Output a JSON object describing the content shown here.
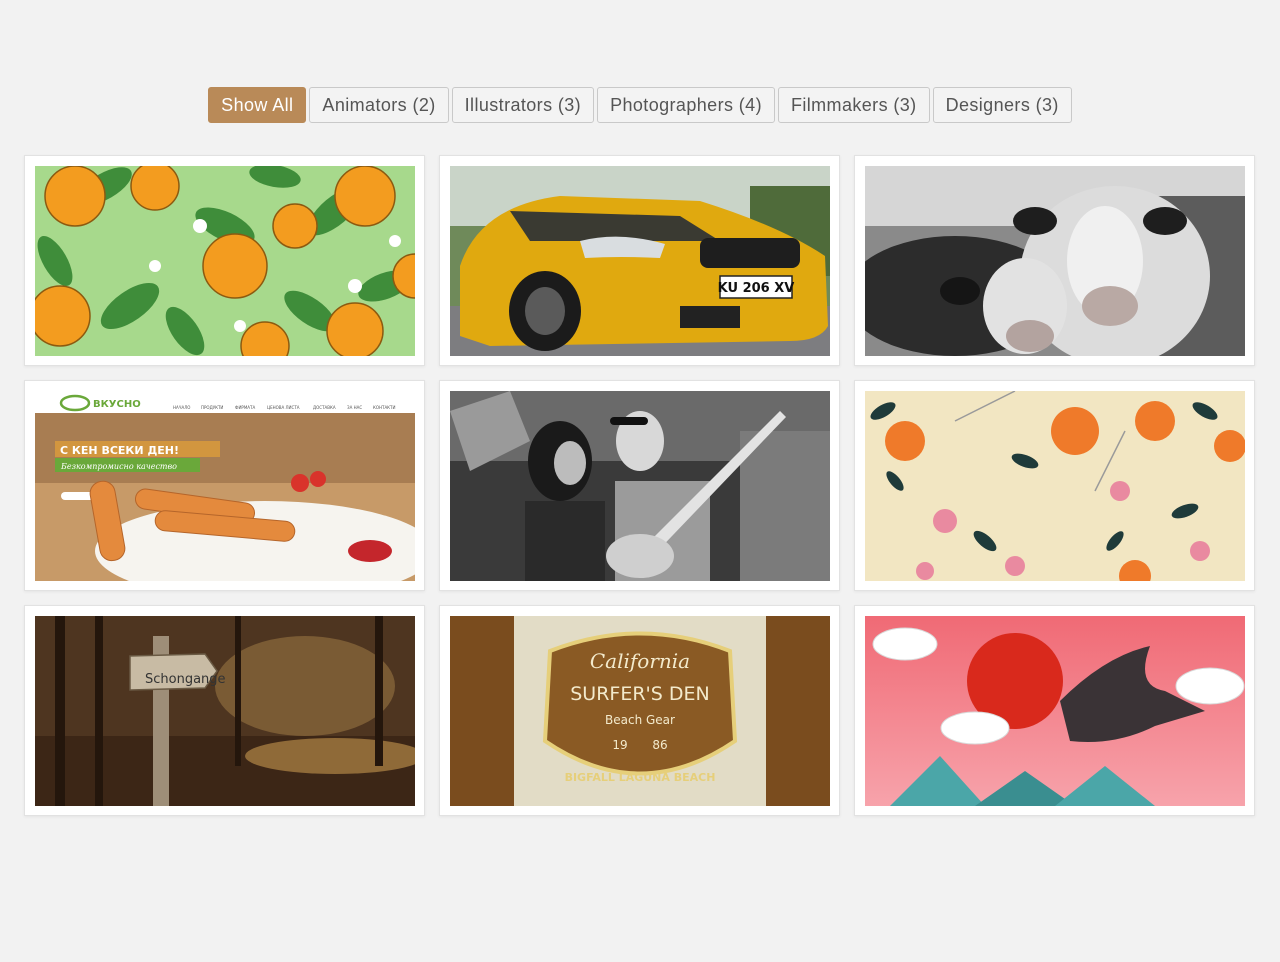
{
  "filters": [
    {
      "label": "Show All",
      "active": true
    },
    {
      "label": "Animators (2)",
      "active": false
    },
    {
      "label": "Illustrators (3)",
      "active": false
    },
    {
      "label": "Photographers (4)",
      "active": false
    },
    {
      "label": "Filmmakers (3)",
      "active": false
    },
    {
      "label": "Designers (3)",
      "active": false
    }
  ],
  "gallery": {
    "food": {
      "brand": "ВКУСНО",
      "headline": "С КЕН ВСЕКИ ДЕН!",
      "tagline": "Безкомпромисно качество",
      "nav_items": [
        "НАЧАЛО",
        "ПРОДУКТИ",
        "ФИРМАТА",
        "ЦЕНОВА ЛИСТА",
        "ДОСТАВКА",
        "ЗА НАС",
        "КОНТАКТИ"
      ]
    },
    "car": {
      "plate": "KU 206 XV"
    },
    "sign": {
      "text": "Schongange"
    },
    "logo": {
      "title": "California",
      "name": "SURFER'S DEN",
      "sub": "Beach Gear",
      "year_left": "19",
      "year_right": "86",
      "arc": "BIGFALL LAGUNA BEACH"
    }
  },
  "colors": {
    "active_filter": "#b98a58",
    "page_bg": "#f2f2f2"
  }
}
